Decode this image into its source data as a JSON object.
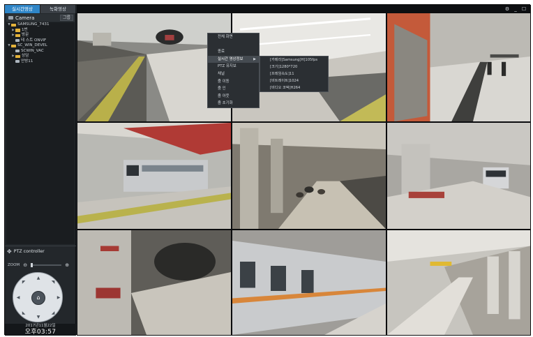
{
  "tabs": [
    {
      "label": "실시간영상"
    },
    {
      "label": "녹화영상"
    }
  ],
  "camera_panel": {
    "title": "Camera",
    "group_button": "그룹"
  },
  "tree": [
    {
      "label": "SAMSUNG_7431",
      "level": 0,
      "kind": "folder"
    },
    {
      "label": "1번",
      "level": 1,
      "kind": "folder"
    },
    {
      "label": "방문",
      "level": 1,
      "kind": "folder"
    },
    {
      "label": "테 스트 ONVIF",
      "level": 1,
      "kind": "camera"
    },
    {
      "label": "SC_WIN_DEVEL",
      "level": 0,
      "kind": "folder"
    },
    {
      "label": "SCWIN_VAC",
      "level": 1,
      "kind": "camera"
    },
    {
      "label": "상담",
      "level": 1,
      "kind": "folder"
    },
    {
      "label": "안방11",
      "level": 1,
      "kind": "camera"
    }
  ],
  "ptz": {
    "title": "PTZ controller",
    "zoom_label": "ZOOM",
    "zoom_minus": "⊖",
    "zoom_plus": "⊕",
    "home_icon": "home-icon",
    "zoom_level": 0
  },
  "clock": {
    "date": "2017년11월22일",
    "time": "오후03:57"
  },
  "window_controls": [
    "⚙",
    "_",
    "☐"
  ],
  "context_menu": {
    "items": [
      {
        "label": "전체 화면"
      },
      {
        "label": ""
      },
      {
        "label": "종료"
      },
      {
        "label": "실시간 영상정보",
        "has_submenu": true,
        "selected": true
      },
      {
        "label": "PTZ 유지보"
      },
      {
        "label": "채널"
      },
      {
        "label": "줌 이동"
      },
      {
        "label": "줌 인"
      },
      {
        "label": "줌 아웃"
      },
      {
        "label": "줌 초기화"
      }
    ]
  },
  "submenu": {
    "items": [
      {
        "label": "[카메라]Samsung[H]105fps"
      },
      {
        "label": "[크기]1280*720"
      },
      {
        "label": "[프레임속도]11"
      },
      {
        "label": "[비트레이트]1024"
      },
      {
        "label": "[비디오 코덱]H264"
      }
    ]
  },
  "colors": {
    "accent": "#2f86c8",
    "folder": "#e4b23a",
    "panel": "#23272b"
  }
}
